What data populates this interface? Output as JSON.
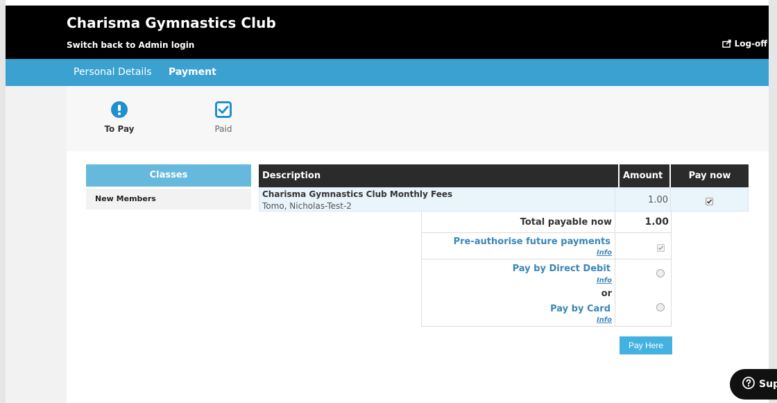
{
  "header": {
    "club_title": "Charisma Gymnastics Club",
    "switch_link": "Switch back to Admin login",
    "logoff": "Log-off"
  },
  "nav": {
    "personal_details": "Personal Details",
    "payment": "Payment",
    "active": "Payment"
  },
  "status": {
    "to_pay": "To Pay",
    "paid": "Paid"
  },
  "classes": {
    "header": "Classes",
    "items": [
      {
        "label": "New Members"
      }
    ]
  },
  "table": {
    "headers": {
      "description": "Description",
      "amount": "Amount",
      "pay_now": "Pay now"
    },
    "rows": [
      {
        "title": "Charisma Gymnastics Club Monthly Fees",
        "member": "Tomo, Nicholas-Test-2",
        "amount": "1.00",
        "pay_now_checked": true
      }
    ]
  },
  "payment": {
    "total_label": "Total payable now",
    "total_value": "1.00",
    "preauth_label": "Pre-authorise future payments",
    "preauth_checked": true,
    "direct_debit_label": "Pay by Direct Debit",
    "or_label": "or",
    "card_label": "Pay by Card",
    "info_label": "Info",
    "pay_button": "Pay Here"
  },
  "support": {
    "label": "Sup"
  },
  "colors": {
    "header_bg": "#000000",
    "nav_bg": "#3aa1d1",
    "accent": "#44b2e1",
    "link": "#3a86b8"
  }
}
